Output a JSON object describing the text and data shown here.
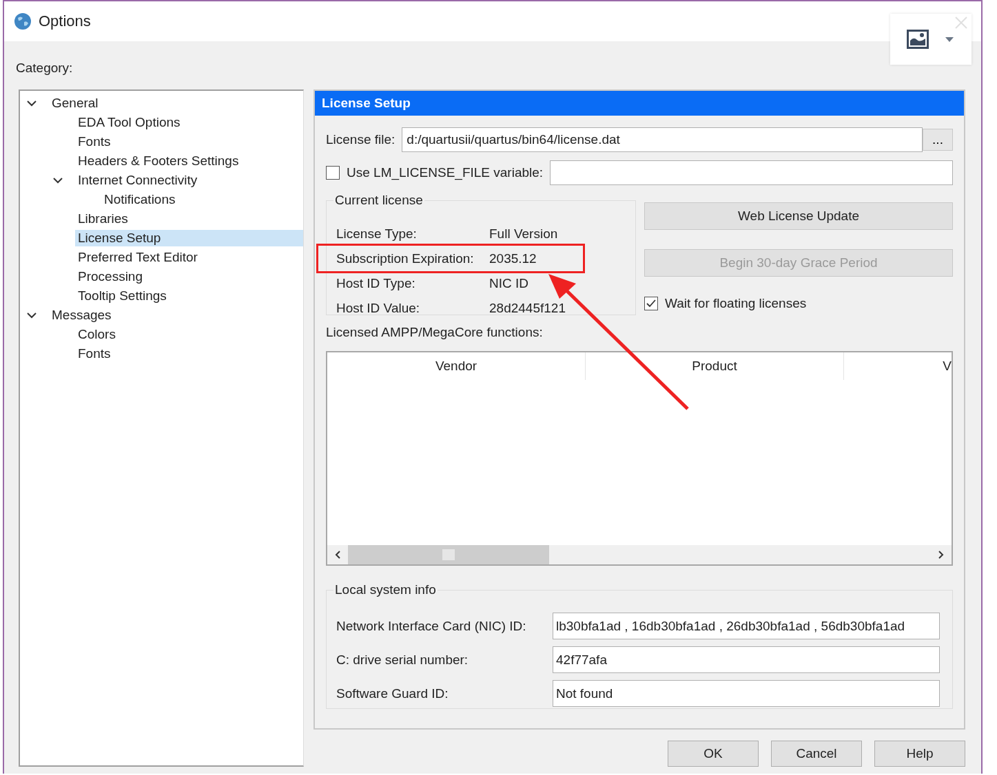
{
  "window": {
    "title": "Options"
  },
  "category_label": "Category:",
  "tree": [
    {
      "label": "General",
      "expanded": true,
      "selected": false,
      "children": [
        {
          "label": "EDA Tool Options",
          "selected": false
        },
        {
          "label": "Fonts",
          "selected": false
        },
        {
          "label": "Headers & Footers Settings",
          "selected": false
        },
        {
          "label": "Internet Connectivity",
          "expanded": true,
          "selected": false,
          "children": [
            {
              "label": "Notifications",
              "selected": false
            }
          ]
        },
        {
          "label": "Libraries",
          "selected": false
        },
        {
          "label": "License Setup",
          "selected": true
        },
        {
          "label": "Preferred Text Editor",
          "selected": false
        },
        {
          "label": "Processing",
          "selected": false
        },
        {
          "label": "Tooltip Settings",
          "selected": false
        }
      ]
    },
    {
      "label": "Messages",
      "expanded": true,
      "selected": false,
      "children": [
        {
          "label": "Colors",
          "selected": false
        },
        {
          "label": "Fonts",
          "selected": false
        }
      ]
    }
  ],
  "panel": {
    "title": "License Setup",
    "license_file": {
      "label": "License file:",
      "value": "d:/quartusii/quartus/bin64/license.dat",
      "browse": "..."
    },
    "lm_variable": {
      "label": "Use LM_LICENSE_FILE variable:",
      "checked": false
    },
    "current_license": {
      "title": "Current license",
      "rows": [
        {
          "label": "License Type:",
          "value": "Full Version"
        },
        {
          "label": "Subscription Expiration:",
          "value": "2035.12"
        },
        {
          "label": "Host ID Type:",
          "value": "NIC ID"
        },
        {
          "label": "Host ID Value:",
          "value": "28d2445f121"
        }
      ]
    },
    "actions": [
      {
        "label": "Web License Update",
        "disabled": false
      },
      {
        "label": "Begin 30-day Grace Period",
        "disabled": true
      }
    ],
    "wait_floating": {
      "label": "Wait for floating licenses",
      "checked": true
    },
    "functions": {
      "label": "Licensed AMPP/MegaCore functions:",
      "columns": [
        "Vendor",
        "Product",
        "V"
      ]
    },
    "local_info": {
      "title": "Local system info",
      "rows": [
        {
          "label": "Network Interface Card (NIC) ID:",
          "value": "lb30bfa1ad , 16db30bfa1ad , 26db30bfa1ad , 56db30bfa1ad"
        },
        {
          "label": "C: drive serial number:",
          "value": "42f77afa"
        },
        {
          "label": "Software Guard ID:",
          "value": "Not found"
        }
      ]
    }
  },
  "buttons": [
    "OK",
    "Cancel",
    "Help"
  ]
}
